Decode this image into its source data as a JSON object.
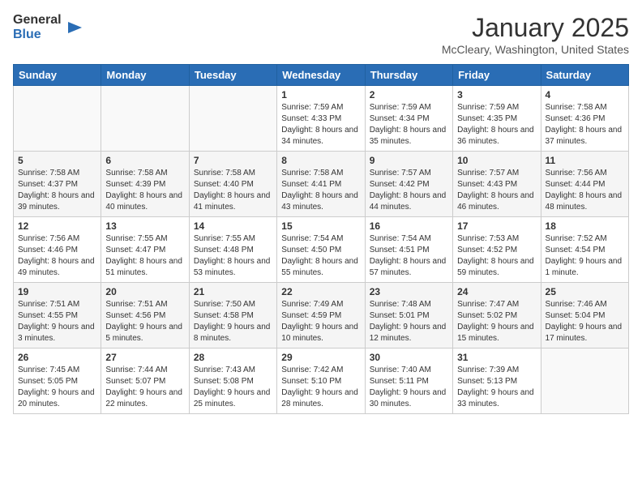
{
  "header": {
    "logo_general": "General",
    "logo_blue": "Blue",
    "month_title": "January 2025",
    "location": "McCleary, Washington, United States"
  },
  "weekdays": [
    "Sunday",
    "Monday",
    "Tuesday",
    "Wednesday",
    "Thursday",
    "Friday",
    "Saturday"
  ],
  "weeks": [
    [
      {
        "day": "",
        "sunrise": "",
        "sunset": "",
        "daylight": ""
      },
      {
        "day": "",
        "sunrise": "",
        "sunset": "",
        "daylight": ""
      },
      {
        "day": "",
        "sunrise": "",
        "sunset": "",
        "daylight": ""
      },
      {
        "day": "1",
        "sunrise": "Sunrise: 7:59 AM",
        "sunset": "Sunset: 4:33 PM",
        "daylight": "Daylight: 8 hours and 34 minutes."
      },
      {
        "day": "2",
        "sunrise": "Sunrise: 7:59 AM",
        "sunset": "Sunset: 4:34 PM",
        "daylight": "Daylight: 8 hours and 35 minutes."
      },
      {
        "day": "3",
        "sunrise": "Sunrise: 7:59 AM",
        "sunset": "Sunset: 4:35 PM",
        "daylight": "Daylight: 8 hours and 36 minutes."
      },
      {
        "day": "4",
        "sunrise": "Sunrise: 7:58 AM",
        "sunset": "Sunset: 4:36 PM",
        "daylight": "Daylight: 8 hours and 37 minutes."
      }
    ],
    [
      {
        "day": "5",
        "sunrise": "Sunrise: 7:58 AM",
        "sunset": "Sunset: 4:37 PM",
        "daylight": "Daylight: 8 hours and 39 minutes."
      },
      {
        "day": "6",
        "sunrise": "Sunrise: 7:58 AM",
        "sunset": "Sunset: 4:39 PM",
        "daylight": "Daylight: 8 hours and 40 minutes."
      },
      {
        "day": "7",
        "sunrise": "Sunrise: 7:58 AM",
        "sunset": "Sunset: 4:40 PM",
        "daylight": "Daylight: 8 hours and 41 minutes."
      },
      {
        "day": "8",
        "sunrise": "Sunrise: 7:58 AM",
        "sunset": "Sunset: 4:41 PM",
        "daylight": "Daylight: 8 hours and 43 minutes."
      },
      {
        "day": "9",
        "sunrise": "Sunrise: 7:57 AM",
        "sunset": "Sunset: 4:42 PM",
        "daylight": "Daylight: 8 hours and 44 minutes."
      },
      {
        "day": "10",
        "sunrise": "Sunrise: 7:57 AM",
        "sunset": "Sunset: 4:43 PM",
        "daylight": "Daylight: 8 hours and 46 minutes."
      },
      {
        "day": "11",
        "sunrise": "Sunrise: 7:56 AM",
        "sunset": "Sunset: 4:44 PM",
        "daylight": "Daylight: 8 hours and 48 minutes."
      }
    ],
    [
      {
        "day": "12",
        "sunrise": "Sunrise: 7:56 AM",
        "sunset": "Sunset: 4:46 PM",
        "daylight": "Daylight: 8 hours and 49 minutes."
      },
      {
        "day": "13",
        "sunrise": "Sunrise: 7:55 AM",
        "sunset": "Sunset: 4:47 PM",
        "daylight": "Daylight: 8 hours and 51 minutes."
      },
      {
        "day": "14",
        "sunrise": "Sunrise: 7:55 AM",
        "sunset": "Sunset: 4:48 PM",
        "daylight": "Daylight: 8 hours and 53 minutes."
      },
      {
        "day": "15",
        "sunrise": "Sunrise: 7:54 AM",
        "sunset": "Sunset: 4:50 PM",
        "daylight": "Daylight: 8 hours and 55 minutes."
      },
      {
        "day": "16",
        "sunrise": "Sunrise: 7:54 AM",
        "sunset": "Sunset: 4:51 PM",
        "daylight": "Daylight: 8 hours and 57 minutes."
      },
      {
        "day": "17",
        "sunrise": "Sunrise: 7:53 AM",
        "sunset": "Sunset: 4:52 PM",
        "daylight": "Daylight: 8 hours and 59 minutes."
      },
      {
        "day": "18",
        "sunrise": "Sunrise: 7:52 AM",
        "sunset": "Sunset: 4:54 PM",
        "daylight": "Daylight: 9 hours and 1 minute."
      }
    ],
    [
      {
        "day": "19",
        "sunrise": "Sunrise: 7:51 AM",
        "sunset": "Sunset: 4:55 PM",
        "daylight": "Daylight: 9 hours and 3 minutes."
      },
      {
        "day": "20",
        "sunrise": "Sunrise: 7:51 AM",
        "sunset": "Sunset: 4:56 PM",
        "daylight": "Daylight: 9 hours and 5 minutes."
      },
      {
        "day": "21",
        "sunrise": "Sunrise: 7:50 AM",
        "sunset": "Sunset: 4:58 PM",
        "daylight": "Daylight: 9 hours and 8 minutes."
      },
      {
        "day": "22",
        "sunrise": "Sunrise: 7:49 AM",
        "sunset": "Sunset: 4:59 PM",
        "daylight": "Daylight: 9 hours and 10 minutes."
      },
      {
        "day": "23",
        "sunrise": "Sunrise: 7:48 AM",
        "sunset": "Sunset: 5:01 PM",
        "daylight": "Daylight: 9 hours and 12 minutes."
      },
      {
        "day": "24",
        "sunrise": "Sunrise: 7:47 AM",
        "sunset": "Sunset: 5:02 PM",
        "daylight": "Daylight: 9 hours and 15 minutes."
      },
      {
        "day": "25",
        "sunrise": "Sunrise: 7:46 AM",
        "sunset": "Sunset: 5:04 PM",
        "daylight": "Daylight: 9 hours and 17 minutes."
      }
    ],
    [
      {
        "day": "26",
        "sunrise": "Sunrise: 7:45 AM",
        "sunset": "Sunset: 5:05 PM",
        "daylight": "Daylight: 9 hours and 20 minutes."
      },
      {
        "day": "27",
        "sunrise": "Sunrise: 7:44 AM",
        "sunset": "Sunset: 5:07 PM",
        "daylight": "Daylight: 9 hours and 22 minutes."
      },
      {
        "day": "28",
        "sunrise": "Sunrise: 7:43 AM",
        "sunset": "Sunset: 5:08 PM",
        "daylight": "Daylight: 9 hours and 25 minutes."
      },
      {
        "day": "29",
        "sunrise": "Sunrise: 7:42 AM",
        "sunset": "Sunset: 5:10 PM",
        "daylight": "Daylight: 9 hours and 28 minutes."
      },
      {
        "day": "30",
        "sunrise": "Sunrise: 7:40 AM",
        "sunset": "Sunset: 5:11 PM",
        "daylight": "Daylight: 9 hours and 30 minutes."
      },
      {
        "day": "31",
        "sunrise": "Sunrise: 7:39 AM",
        "sunset": "Sunset: 5:13 PM",
        "daylight": "Daylight: 9 hours and 33 minutes."
      },
      {
        "day": "",
        "sunrise": "",
        "sunset": "",
        "daylight": ""
      }
    ]
  ]
}
